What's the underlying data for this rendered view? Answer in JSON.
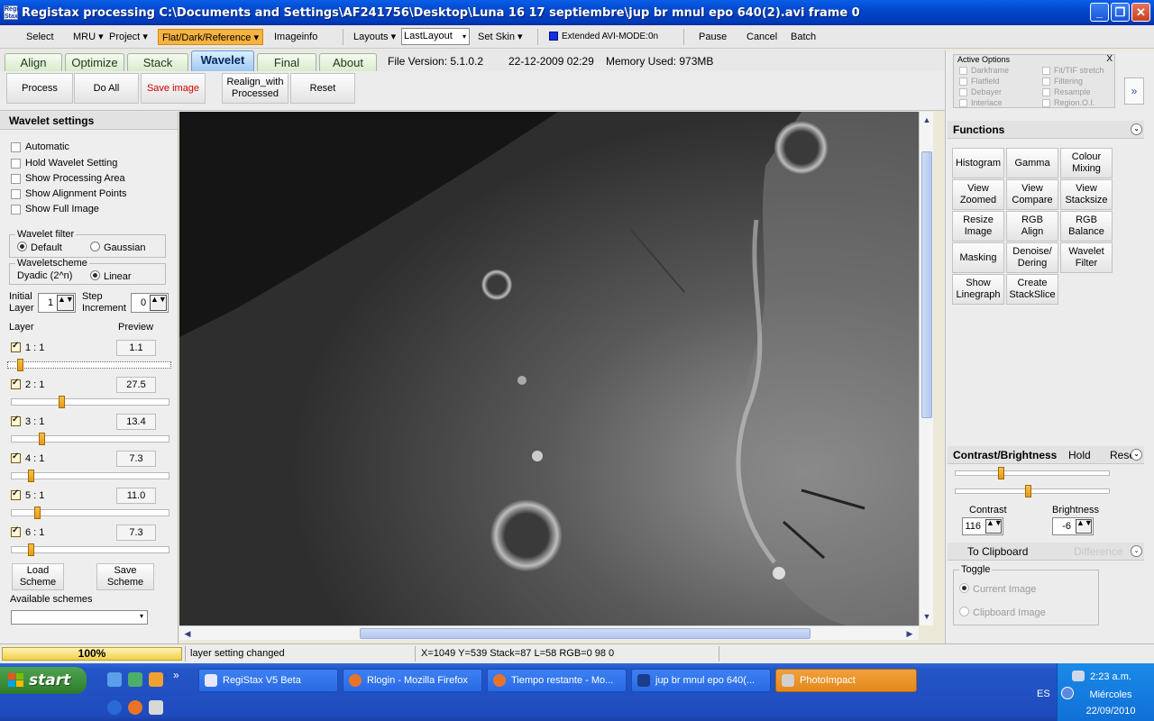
{
  "window": {
    "icon_text": "Regi Stax",
    "title": "Registax processing C:\\Documents and Settings\\AF241756\\Desktop\\Luna 16 17 septiembre\\jup  br mnul epo 640(2).avi frame 0",
    "minimize": "_",
    "maximize": "❐",
    "close": "✕"
  },
  "menu": {
    "select": "Select",
    "mru": "MRU",
    "project": "Project",
    "flat_dark": "Flat/Dark/Reference",
    "imageinfo": "Imageinfo",
    "layouts": "Layouts",
    "layout_value": "LastLayout",
    "set_skin": "Set Skin",
    "extended": "Extended AVI-MODE:0n",
    "pause": "Pause",
    "cancel": "Cancel",
    "batch": "Batch",
    "dropdown_arrow": "▾"
  },
  "tabs": [
    {
      "label": "Align"
    },
    {
      "label": "Optimize"
    },
    {
      "label": "Stack"
    },
    {
      "label": "Wavelet"
    },
    {
      "label": "Final"
    },
    {
      "label": "About"
    }
  ],
  "file_info": {
    "version": "File Version: 5.1.0.2",
    "date": "22-12-2009 02:29",
    "memory": "Memory Used: 973MB"
  },
  "actions": {
    "process": "Process",
    "do_all": "Do All",
    "save_image": "Save image",
    "realign_1": "Realign_with",
    "realign_2": "Processed",
    "reset": "Reset"
  },
  "wavelet": {
    "heading": "Wavelet settings",
    "automatic": "Automatic",
    "hold": "Hold Wavelet Setting",
    "show_processing": "Show Processing Area",
    "show_alignment": "Show Alignment Points",
    "show_full": "Show Full Image",
    "filter_legend": "Wavelet filter",
    "filter_default": "Default",
    "filter_gaussian": "Gaussian",
    "scheme_legend": "Waveletscheme",
    "scheme_dyadic": "Dyadic (2^n)",
    "scheme_linear": "Linear",
    "initial": "Initial",
    "layer_word": "Layer",
    "initial_value": "1",
    "step": "Step",
    "increment": "Increment",
    "step_value": "0",
    "layer_header": "Layer",
    "preview_header": "Preview",
    "spin_arrows": "▲▼",
    "layers": [
      {
        "label": "1 : 1",
        "value": "1.1",
        "position": 0.06
      },
      {
        "label": "2 : 1",
        "value": "27.5",
        "position": 0.31
      },
      {
        "label": "3 : 1",
        "value": "13.4",
        "position": 0.18
      },
      {
        "label": "4 : 1",
        "value": "7.3",
        "position": 0.11
      },
      {
        "label": "5 : 1",
        "value": "11.0",
        "position": 0.15
      },
      {
        "label": "6 : 1",
        "value": "7.3",
        "position": 0.11
      }
    ],
    "load_1": "Load",
    "load_2": "Scheme",
    "save_1": "Save",
    "save_2": "Scheme",
    "available": "Available schemes"
  },
  "right": {
    "active_options": "Active Options",
    "close_x": "X",
    "opts": {
      "darkframe": "Darkframe",
      "flatfield": "Flatfield",
      "debayer": "Debayer",
      "interlace": "Interlace",
      "fit_tif": "Fit/TIF stretch",
      "filtering": "Filtering",
      "resample": "Resample",
      "region": "Region.O.I."
    },
    "expand": "»",
    "functions": "Functions",
    "collapse": "⌄",
    "fn": {
      "histogram": "Histogram",
      "gamma": "Gamma",
      "colour_1": "Colour",
      "colour_2": "Mixing",
      "vz_1": "View",
      "vz_2": "Zoomed",
      "vc_1": "View",
      "vc_2": "Compare",
      "vs_1": "View",
      "vs_2": "Stacksize",
      "ri_1": "Resize",
      "ri_2": "Image",
      "rgba_1": "RGB",
      "rgba_2": "Align",
      "rgbb_1": "RGB",
      "rgbb_2": "Balance",
      "masking": "Masking",
      "dd_1": "Denoise/",
      "dd_2": "Dering",
      "wf_1": "Wavelet",
      "wf_2": "Filter",
      "sl_1": "Show",
      "sl_2": "Linegraph",
      "cs_1": "Create",
      "cs_2": "StackSlice"
    },
    "cb": {
      "heading": "Contrast/Brightness",
      "hold": "Hold",
      "reset": "Reset",
      "contrast_label": "Contrast",
      "contrast_value": "116",
      "brightness_label": "Brightness",
      "brightness_value": "-6",
      "contrast_pos": 0.29,
      "brightness_pos": 0.47
    },
    "clipboard": {
      "heading": "To Clipboard",
      "difference": "Difference",
      "toggle": "Toggle",
      "current": "Current Image",
      "clip": "Clipboard Image"
    }
  },
  "status": {
    "progress": "100%",
    "message": "layer setting changed",
    "coords": "X=1049 Y=539 Stack=87 L=58 RGB=0 98 0"
  },
  "taskbar": {
    "start": "start",
    "tasks": [
      {
        "label": "RegiStax V5 Beta"
      },
      {
        "label": "Rlogin - Mozilla Firefox"
      },
      {
        "label": "Tiempo restante - Mo..."
      },
      {
        "label": "jup  br mnul epo 640(..."
      },
      {
        "label": "PhotoImpact"
      }
    ],
    "lang": "ES",
    "time": "2:23 a.m.",
    "day": "Miércoles",
    "date": "22/09/2010",
    "more": "»"
  },
  "colors": {
    "accent_orange": "#f7b340",
    "tab_active": "#9ec8f0",
    "save_red": "#d40000"
  }
}
